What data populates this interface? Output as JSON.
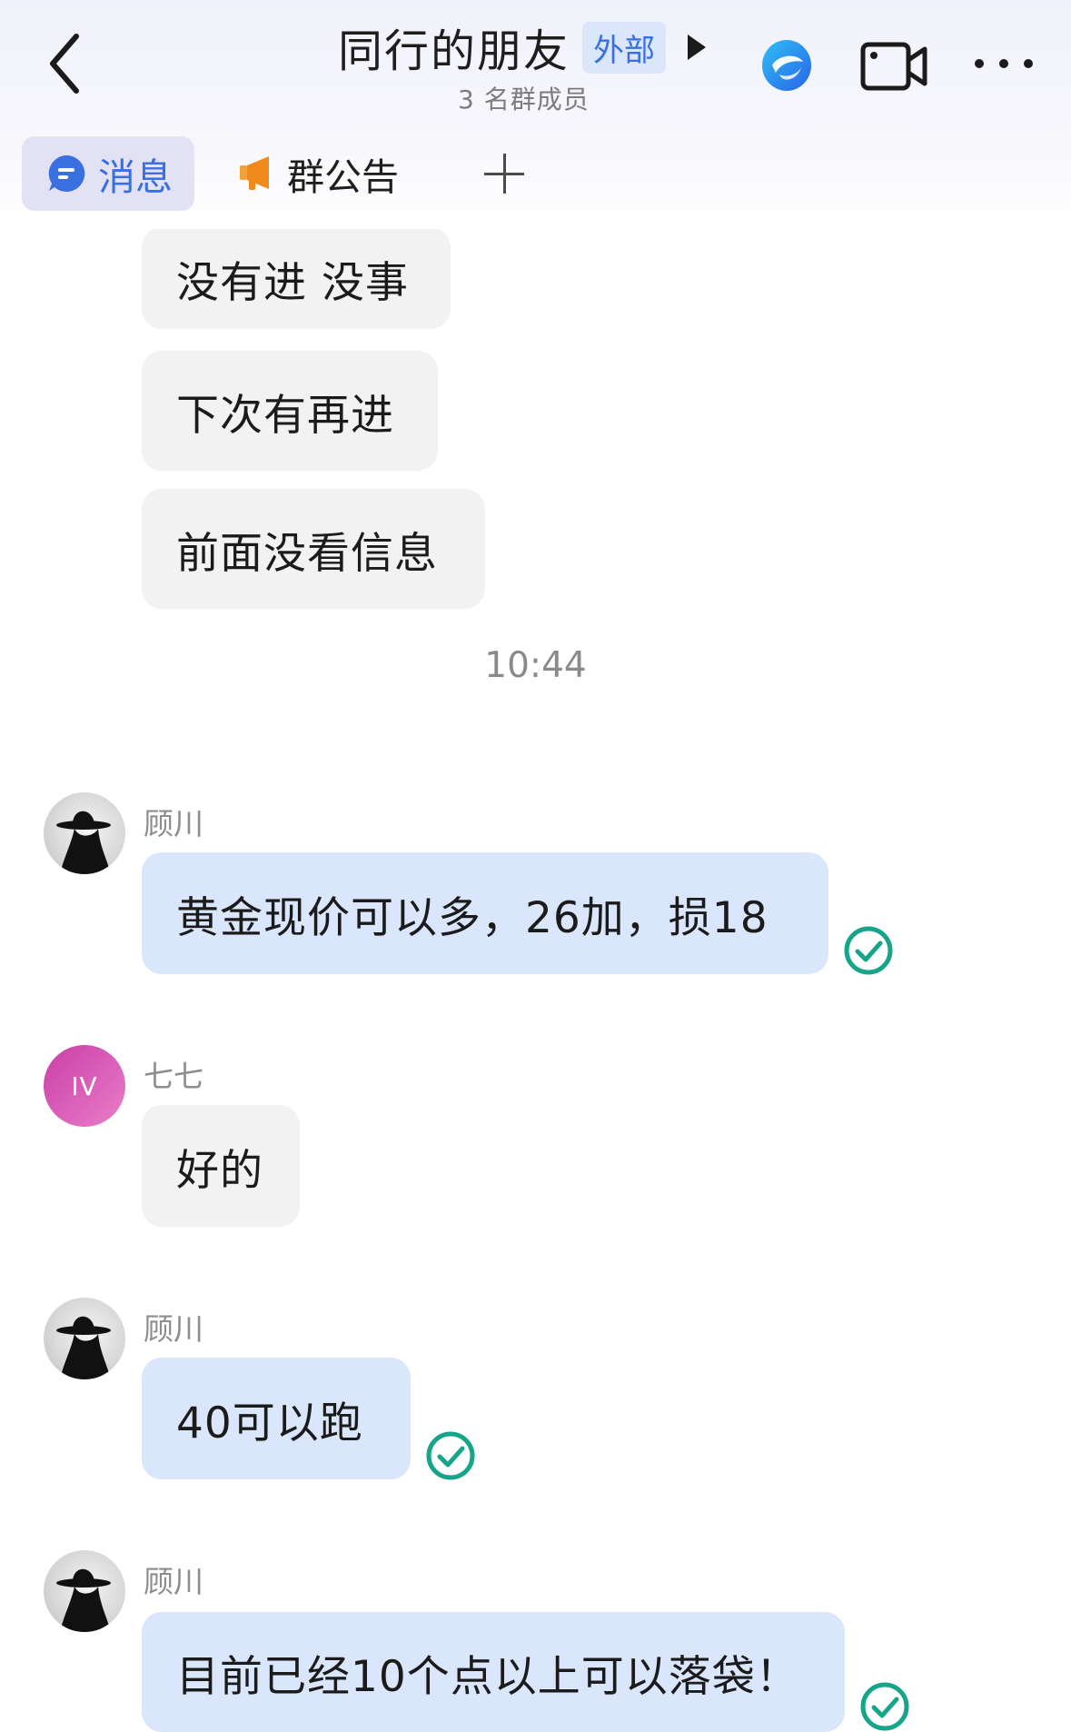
{
  "header": {
    "title": "同行的朋友",
    "badge": "外部",
    "subtitle": "3 名群成员",
    "icons": {
      "back": "chevron-left-icon",
      "play": "play-triangle-icon",
      "ai": "ai-assistant-icon",
      "video": "video-call-icon",
      "more": "more-dots-icon"
    }
  },
  "tabs": [
    {
      "label": "消息",
      "icon": "message-bubble-icon",
      "active": true
    },
    {
      "label": "群公告",
      "icon": "megaphone-icon",
      "active": false
    },
    {
      "label": "",
      "icon": "plus-icon",
      "active": false
    }
  ],
  "messages_before": [
    {
      "text": "没有进 没事"
    },
    {
      "text": "下次有再进"
    },
    {
      "text": "前面没看信息"
    }
  ],
  "timestamp": "10:44",
  "messages": [
    {
      "sender": "顾川",
      "text": "黄金现价可以多，26加，损18",
      "status": "read-check-icon"
    },
    {
      "sender": "七七",
      "avatar_text": "IV",
      "text": "好的"
    },
    {
      "sender": "顾川",
      "text": "40可以跑",
      "status": "read-check-icon"
    },
    {
      "sender": "顾川",
      "text": "目前已经10个点以上可以落袋！",
      "status": "read-check-icon"
    }
  ],
  "colors": {
    "accent": "#3a6fe0",
    "own_bubble": "#d9e6fb",
    "other_bubble": "#f2f2f3",
    "check": "#17a589",
    "megaphone": "#f08a1c"
  }
}
